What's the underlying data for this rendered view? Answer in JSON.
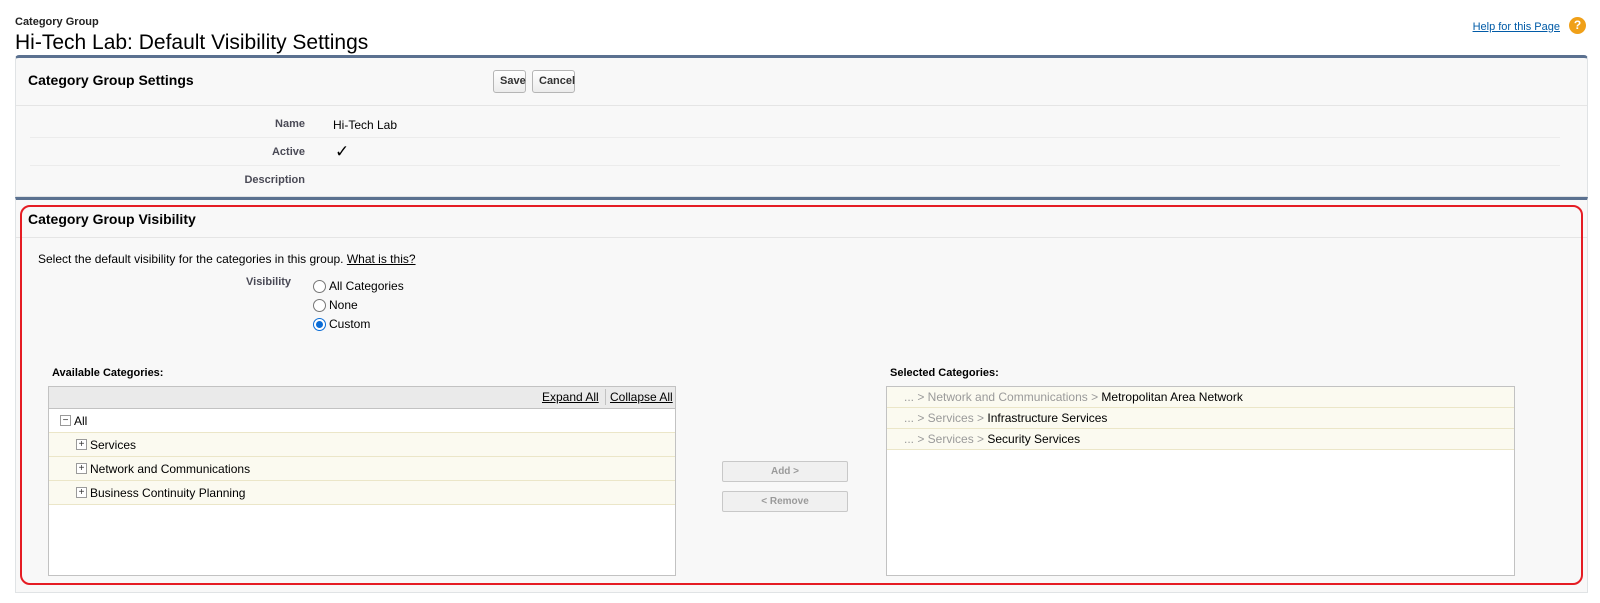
{
  "header": {
    "page_type": "Category Group",
    "title": "Hi-Tech Lab: Default Visibility Settings",
    "help_link": "Help for this Page",
    "help_icon": "?"
  },
  "settings": {
    "title": "Category Group Settings",
    "save_label": "Save",
    "cancel_label": "Cancel",
    "fields": {
      "name_label": "Name",
      "name_value": "Hi-Tech Lab",
      "active_label": "Active",
      "active_value": "✓",
      "description_label": "Description"
    }
  },
  "visibility": {
    "title": "Category Group Visibility",
    "intro": "Select the default visibility for the categories in this group. ",
    "intro_link": "What is this?",
    "label": "Visibility",
    "options": [
      "All Categories",
      "None",
      "Custom"
    ],
    "selected_option": "Custom",
    "available_label": "Available Categories:",
    "expand_all": "Expand All",
    "collapse_all": "Collapse All",
    "tree": {
      "root": "All",
      "children": [
        "Services",
        "Network and Communications",
        "Business Continuity Planning"
      ]
    },
    "add_label": "Add >",
    "remove_label": "< Remove",
    "selected_label": "Selected Categories:",
    "selected_items": [
      {
        "path": "... > Network and Communications > ",
        "leaf": "Metropolitan Area Network"
      },
      {
        "path": "... > Services > ",
        "leaf": "Infrastructure Services"
      },
      {
        "path": "... > Services > ",
        "leaf": "Security Services"
      }
    ]
  },
  "colors": {
    "accent_border": "#5b7190",
    "highlight_outline": "#e51c23",
    "link": "#015ba7",
    "help_icon": "#f0a018"
  }
}
